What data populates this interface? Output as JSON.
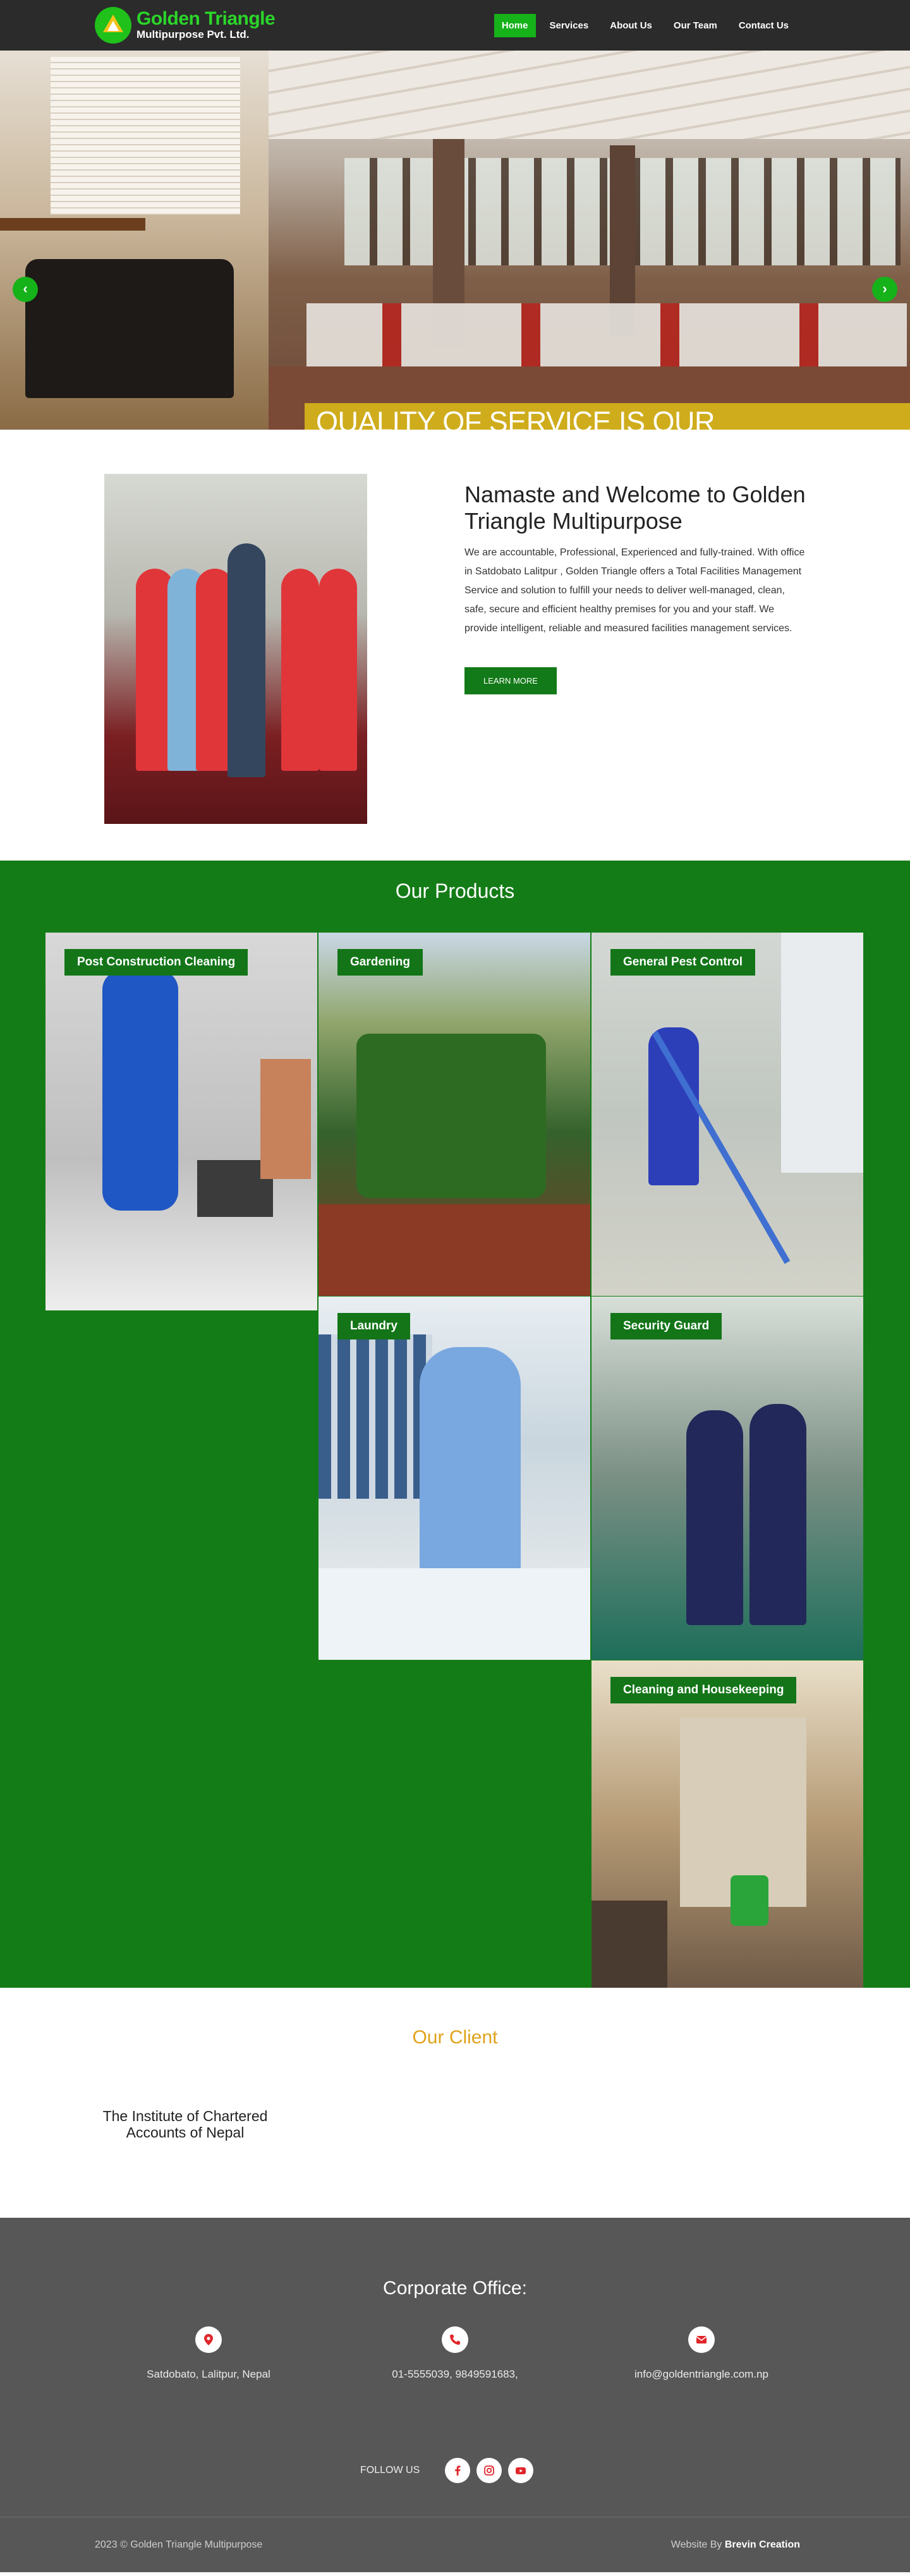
{
  "header": {
    "logo_line1": "Golden Triangle",
    "logo_line2": "Multipurpose Pvt. Ltd.",
    "nav": [
      {
        "label": "Home",
        "active": true
      },
      {
        "label": "Services"
      },
      {
        "label": "About Us"
      },
      {
        "label": "Our Team"
      },
      {
        "label": "Contact Us"
      }
    ]
  },
  "hero": {
    "caption": "QUALITY OF SERVICE IS OUR COMMITMENT",
    "prev_icon": "chevron-left-icon",
    "next_icon": "chevron-right-icon"
  },
  "welcome": {
    "title": "Namaste and Welcome to Golden Triangle Multipurpose",
    "body": "We are accountable, Professional, Experienced and fully-trained. With office in Satdobato Lalitpur , Golden Triangle offers a Total Facilities Management Service and solution to fulfill your needs to deliver well-managed, clean, safe, secure and efficient healthy premises for you and your staff. We provide intelligent, reliable and measured facilities management services.",
    "button": "LEARN MORE"
  },
  "products": {
    "title": "Our Products",
    "items": [
      {
        "label": "Post Construction Cleaning"
      },
      {
        "label": "Gardening"
      },
      {
        "label": "General Pest Control"
      },
      {
        "label": "Laundry"
      },
      {
        "label": "Security Guard"
      },
      {
        "label": "Cleaning and Housekeeping"
      }
    ]
  },
  "clients": {
    "title": "Our Client",
    "items": [
      "The Institute of Chartered Accounts of Nepal"
    ]
  },
  "footer": {
    "title": "Corporate Office:",
    "address": "Satdobato, Lalitpur, Nepal",
    "phone": "01-5555039, 9849591683,",
    "email": "info@goldentriangle.com.np",
    "follow_label": "FOLLOW US",
    "social": [
      "facebook-icon",
      "instagram-icon",
      "youtube-icon"
    ],
    "copyright": "2023 © Golden Triangle Multipurpose",
    "credit_prefix": "Website By",
    "credit_name": "Brevin Creation"
  },
  "colors": {
    "brand_green": "#16b21a",
    "section_green": "#147c17",
    "accent_gold": "#e0a21a",
    "header_bg": "#2b2b2b",
    "footer_bg": "#575757"
  }
}
